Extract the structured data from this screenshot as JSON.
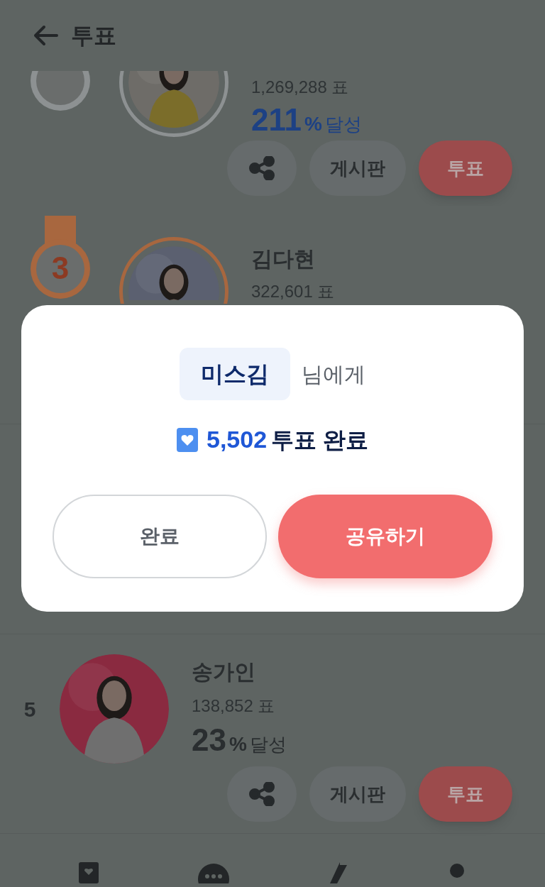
{
  "header": {
    "title": "투표"
  },
  "candidates": [
    {
      "kind": "medal",
      "color": "#8d9192",
      "votes": "1,269,288 표",
      "percent": "211",
      "percent_unit": "%",
      "achieve_label": "달성",
      "highlight": true,
      "board_label": "게시판",
      "vote_label": "투표"
    },
    {
      "kind": "medal",
      "rank": "3",
      "color": "#a8673f",
      "name": "김다현",
      "votes": "322,601 표"
    },
    {
      "kind": "number",
      "rank": "5",
      "name": "송가인",
      "votes": "138,852 표",
      "percent": "23",
      "percent_unit": "%",
      "achieve_label": "달성",
      "highlight": false,
      "board_label": "게시판",
      "vote_label": "투표"
    }
  ],
  "dialog": {
    "recipient": "미스김",
    "recipient_suffix": "님에게",
    "vote_count": "5,502",
    "vote_suffix": "투표 완료",
    "buttons": [
      {
        "label": "완료",
        "kind": "secondary"
      },
      {
        "label": "공유하기",
        "kind": "primary"
      }
    ]
  }
}
